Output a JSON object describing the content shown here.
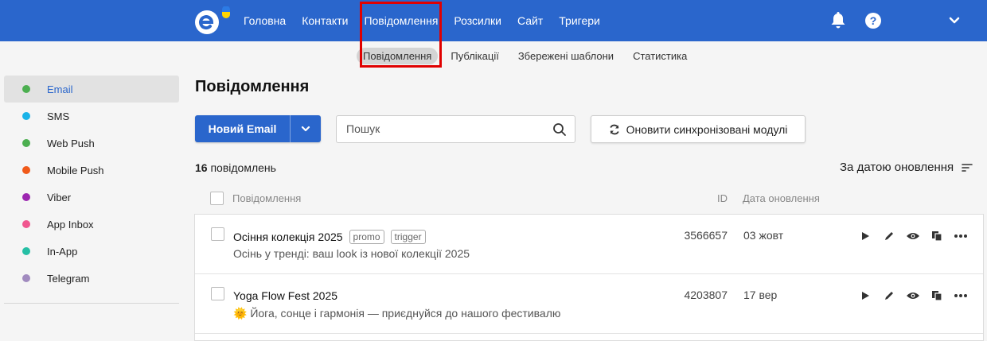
{
  "header": {
    "nav": [
      "Головна",
      "Контакти",
      "Повідомлення",
      "Розсилки",
      "Сайт",
      "Тригери"
    ],
    "active_nav": "Повідомлення",
    "brand_color": "#2a66cc",
    "highlight_color": "#e00000",
    "icons": [
      "logo-icon",
      "bell-icon",
      "help-icon",
      "chevron-down-icon"
    ],
    "help_glyph": "?"
  },
  "subnav": {
    "items": [
      "Повідомлення",
      "Публікації",
      "Збережені шаблони",
      "Статистика"
    ],
    "active": "Повідомлення"
  },
  "sidebar": {
    "items": [
      {
        "label": "Email",
        "color": "#4caf50"
      },
      {
        "label": "SMS",
        "color": "#1ab3e8"
      },
      {
        "label": "Web Push",
        "color": "#4caf50"
      },
      {
        "label": "Mobile Push",
        "color": "#f05a1a"
      },
      {
        "label": "Viber",
        "color": "#9c27b0"
      },
      {
        "label": "App Inbox",
        "color": "#f0568f"
      },
      {
        "label": "In-App",
        "color": "#26bfa5"
      },
      {
        "label": "Telegram",
        "color": "#a18bbf"
      }
    ],
    "active": "Email"
  },
  "main": {
    "title": "Повідомлення",
    "new_button": "Новий Email",
    "search_placeholder": "Пошук",
    "sync_button": "Оновити синхронізовані модулі",
    "count_number": "16",
    "count_text": "повідомлень",
    "sort_label": "За датою оновлення",
    "columns": {
      "message": "Повідомлення",
      "id": "ID",
      "date": "Дата оновлення"
    }
  },
  "messages": [
    {
      "name": "Осіння колекція 2025",
      "tags": [
        "promo",
        "trigger"
      ],
      "subject": "Осінь у тренді: ваш look із нової колекції 2025",
      "id": "3566657",
      "date": "03 жовт"
    },
    {
      "name": "Yoga Flow Fest 2025",
      "tags": [],
      "subject": "🌞 Йога, сонце і гармонія — приєднуйся до нашого фестивалю",
      "id": "4203807",
      "date": "17 вер"
    }
  ]
}
